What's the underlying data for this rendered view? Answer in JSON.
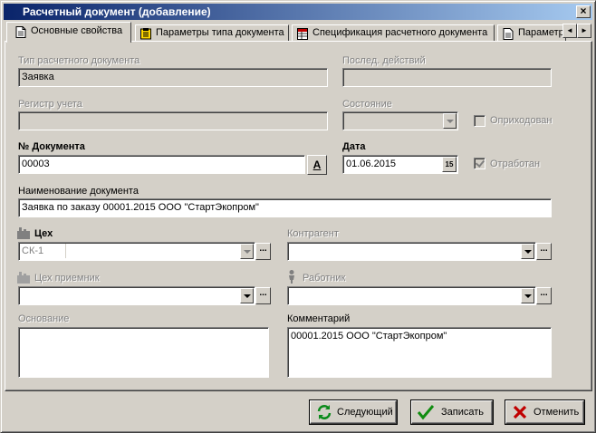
{
  "window": {
    "title": "Расчетный документ (добавление)",
    "close_label": "×"
  },
  "tabs": [
    {
      "label": "Основные свойства",
      "icon": "document-icon",
      "active": true
    },
    {
      "label": "Параметры типа документа",
      "icon": "parameters-icon",
      "active": false
    },
    {
      "label": "Спецификация расчетного документа",
      "icon": "spreadsheet-icon",
      "active": false
    },
    {
      "label": "Параметры",
      "icon": "document-icon",
      "active": false
    }
  ],
  "tab_scroll": {
    "left": "◄",
    "right": "►"
  },
  "form": {
    "doc_type": {
      "label": "Тип расчетного документа",
      "value": "Заявка"
    },
    "last_action": {
      "label": "Послед. действий",
      "value": ""
    },
    "registry": {
      "label": "Регистр учета",
      "value": ""
    },
    "state": {
      "label": "Состояние",
      "value": ""
    },
    "received": {
      "label": "Оприходован",
      "checked": false
    },
    "doc_number": {
      "label": "№ Документа",
      "value": "00003",
      "auto_button": "A"
    },
    "date": {
      "label": "Дата",
      "value": "01.06.2015",
      "calendar_button": "15"
    },
    "processed": {
      "label": "Отработан",
      "checked": true
    },
    "doc_name": {
      "label": "Наименование документа",
      "value": "Заявка по заказу 00001.2015 ООО \"СтартЭкопром\""
    },
    "shop": {
      "label": "Цех",
      "value": "СК-1"
    },
    "counterparty": {
      "label": "Контрагент",
      "value": ""
    },
    "receiving_shop": {
      "label": "Цех приемник",
      "value": ""
    },
    "worker": {
      "label": "Работник",
      "value": ""
    },
    "basis": {
      "label": "Основание",
      "value": ""
    },
    "comment": {
      "label": "Комментарий",
      "value": "00001.2015 ООО \"СтартЭкопром\""
    },
    "ellipsis": "..."
  },
  "buttons": {
    "next": "Следующий",
    "save": "Записать",
    "cancel": "Отменить"
  },
  "colors": {
    "title_start": "#0a246a",
    "title_end": "#a6caf0",
    "face": "#d4d0c8",
    "disabled_text": "#808080"
  }
}
